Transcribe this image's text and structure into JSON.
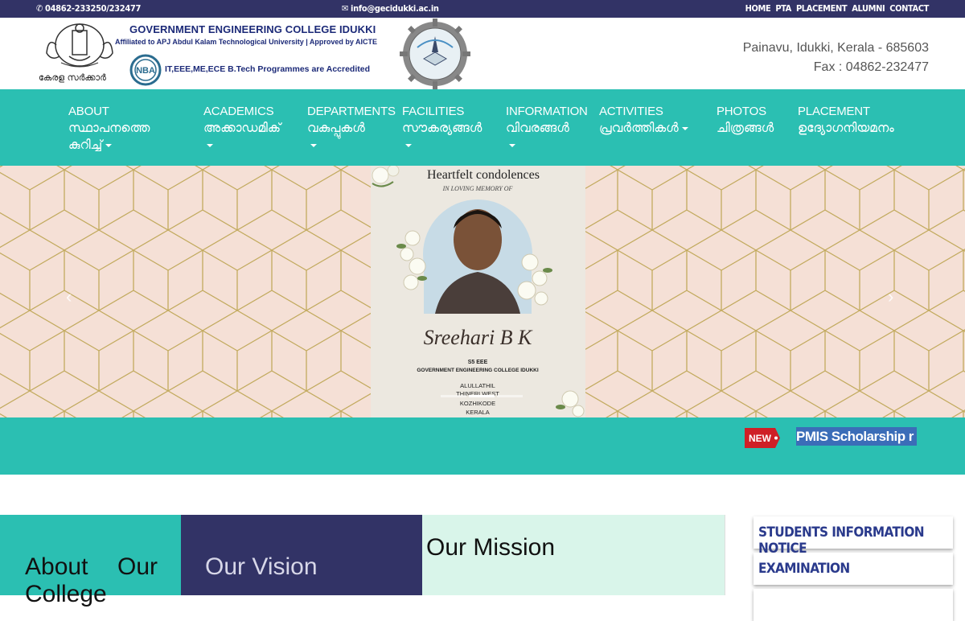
{
  "topbar": {
    "phone": "04862-233250/232477",
    "email": "info@gecidukki.ac.in",
    "links": [
      "HOME",
      "PTA",
      "PLACEMENT",
      "ALUMNI",
      "CONTACT"
    ]
  },
  "header": {
    "emblem_label": "കേരള സർക്കാർ",
    "college_name": "GOVERNMENT ENGINEERING COLLEGE IDUKKI",
    "affiliation": "Affiliated to APJ Abdul Kalam Technological University | Approved by AICTE",
    "nba_logo_text": "NBA",
    "accreditation": "IT,EEE,ME,ECE B.Tech Programmes are Accredited",
    "address_line1": "Painavu, Idukki, Kerala - 685603",
    "address_line2": "Fax : 04862-232477"
  },
  "nav": {
    "items": [
      {
        "en": "ABOUT",
        "ml": "സ്ഥാപനത്തെ",
        "ml2": "കുറിച്ച്",
        "dropdown": true
      },
      {
        "en": "ACADEMICS",
        "ml": "അക്കാഡമിക്",
        "dropdown": true
      },
      {
        "en": "DEPARTMENTS",
        "ml": "വകുപ്പുകൾ",
        "dropdown": true
      },
      {
        "en": "FACILITIES",
        "ml": "സൗകര്യങ്ങൾ",
        "dropdown": true
      },
      {
        "en": "INFORMATION",
        "ml": "വിവരങ്ങൾ",
        "dropdown": true
      },
      {
        "en": "ACTIVITIES",
        "ml": "പ്രവർത്തികൾ",
        "dropdown": true
      },
      {
        "en": "PHOTOS",
        "ml": "ചിത്രങ്ങൾ",
        "dropdown": false
      },
      {
        "en": "PLACEMENT",
        "ml": "ഉദ്യോഗനിയമനം",
        "dropdown": false
      }
    ]
  },
  "slider": {
    "heading": "Heartfelt condolences",
    "subheading": "IN LOVING MEMORY OF",
    "name": "Sreehari B K",
    "class": "S5 EEE",
    "college": "GOVERNMENT ENGINEERING COLLEGE IDUKKI",
    "address_lines": [
      "ALULLATHIL",
      "THINERI WEST",
      "KOZHIKODE",
      "KERALA"
    ],
    "slide_count": 3,
    "active_index": 1,
    "prev_glyph": "‹",
    "next_glyph": "›"
  },
  "ticker": {
    "badge": "NEW",
    "text": "PMIS Scholarship r"
  },
  "cards": {
    "about_line1": "About Our",
    "about_line2": "College",
    "vision": "Our Vision",
    "mission": "Our Mission",
    "notices": [
      "STUDENTS INFORMATION NOTICE",
      "EXAMINATION",
      ""
    ]
  },
  "colors": {
    "topbar": "#323366",
    "teal": "#2bbfb2",
    "navy": "#323366",
    "mint": "#d9f5ea",
    "brand_blue": "#1c2a78"
  }
}
